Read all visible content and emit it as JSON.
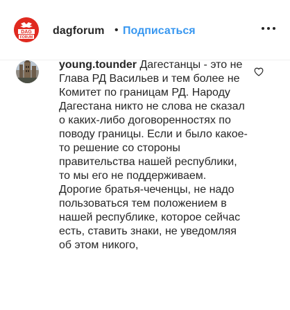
{
  "post": {
    "username": "dagforum",
    "separator": "•",
    "follow_label": "Подписаться",
    "avatar_text_top": "DAG",
    "avatar_text_bottom": "FORUM"
  },
  "comment": {
    "username": "young.tounder",
    "text": "Дагестанцы - это не Глава РД Васильев и тем более не Комитет по границам РД. Народу Дагестана никто не слова не сказал о каких-либо договоренностях по поводу границы. Если и было какое-то решение со стороны правительства нашей республики, то мы его не поддерживаем. Дорогие братья-чеченцы, не надо пользоваться тем положением в нашей республике, которое сейчас есть, ставить знаки, не уведомляя об этом никого,"
  },
  "colors": {
    "link": "#3897f0",
    "text": "#262626",
    "avatar_brand": "#e02a20"
  },
  "icons": {
    "more": "more-horizontal-icon",
    "like": "heart-outline-icon"
  }
}
